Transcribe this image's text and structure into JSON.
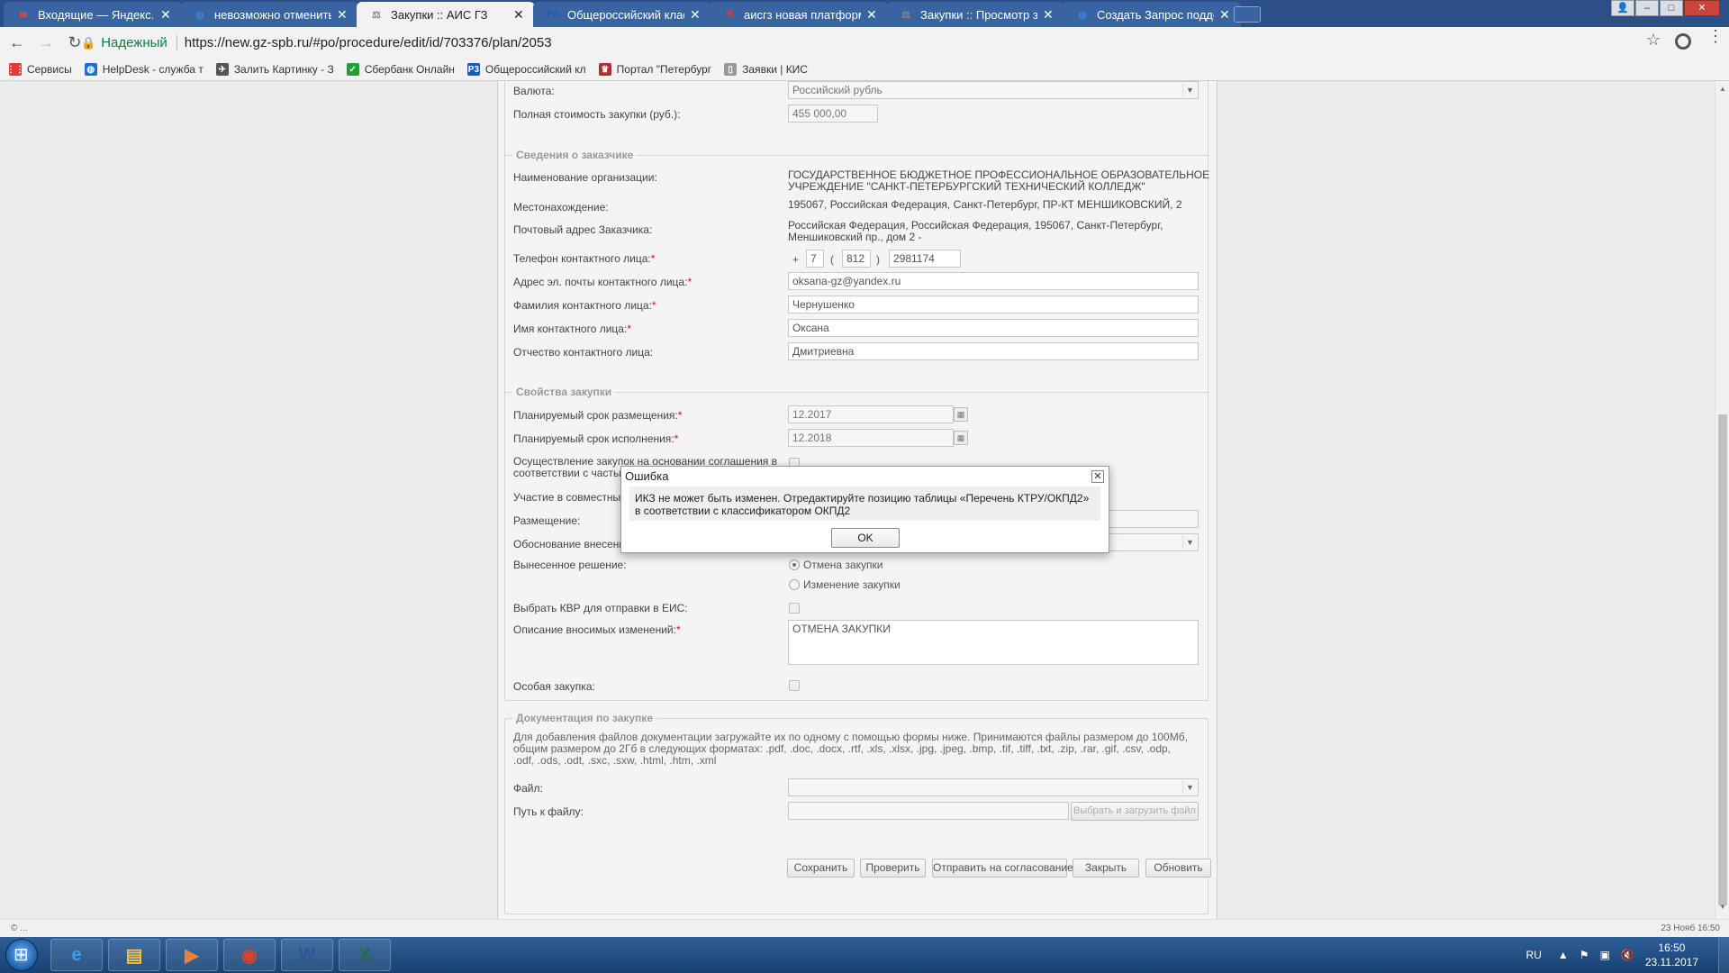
{
  "browser": {
    "tabs": [
      {
        "title": "Входящие — Яндекс.По",
        "icon": "mail-icon",
        "color": "#e04a3a",
        "active": false
      },
      {
        "title": "невозможно отменить",
        "icon": "globe-icon",
        "color": "#3a7fd5",
        "active": false
      },
      {
        "title": "Закупки :: АИС ГЗ",
        "icon": "scales-icon",
        "color": "#888888",
        "active": true
      },
      {
        "title": "Общероссийский класс",
        "icon": "p3-icon",
        "color": "#1a5bb5",
        "active": false
      },
      {
        "title": "аисгз новая платформа",
        "icon": "yandex-icon",
        "color": "#e53935",
        "active": false
      },
      {
        "title": "Закупки :: Просмотр за",
        "icon": "scales-icon",
        "color": "#888888",
        "active": false
      },
      {
        "title": "Создать Запрос подде",
        "icon": "globe-icon",
        "color": "#3a7fd5",
        "active": false
      }
    ],
    "secure_label": "Надежный",
    "url": "https://new.gz-spb.ru/#po/procedure/edit/id/703376/plan/2053",
    "bookmarks": [
      {
        "label": "Сервисы",
        "icon": "apps-icon",
        "color": "#e53935"
      },
      {
        "label": "HelpDesk - служба т",
        "icon": "helpdesk-icon",
        "color": "#1e6fd9"
      },
      {
        "label": "Залить Картинку - З",
        "icon": "image-icon",
        "color": "#555555"
      },
      {
        "label": "Сбербанк Онлайн",
        "icon": "sber-icon",
        "color": "#21a038"
      },
      {
        "label": "Общероссийский кл",
        "icon": "p3-icon",
        "color": "#1a5bb5"
      },
      {
        "label": "Портал \"Петербург",
        "icon": "emblem-icon",
        "color": "#b03030"
      },
      {
        "label": "Заявки | КИС",
        "icon": "page-icon",
        "color": "#999999"
      }
    ]
  },
  "form": {
    "currency": {
      "label": "Валюта:",
      "value": "Российский рубль"
    },
    "total_cost": {
      "label": "Полная стоимость закупки (руб.):",
      "value": "455 000,00"
    },
    "customer": {
      "legend": "Сведения о заказчике",
      "org_name_label": "Наименование организации:",
      "org_name_line1": "ГОСУДАРСТВЕННОЕ БЮДЖЕТНОЕ ПРОФЕССИОНАЛЬНОЕ ОБРАЗОВАТЕЛЬНОЕ",
      "org_name_line2": "УЧРЕЖДЕНИЕ \"САНКТ-ПЕТЕРБУРГСКИЙ ТЕХНИЧЕСКИЙ КОЛЛЕДЖ\"",
      "location_label": "Местонахождение:",
      "location_value": "195067, Российская Федерация, Санкт-Петербург, ПР-КТ МЕНШИКОВСКИЙ, 2",
      "postal_label": "Почтовый адрес Заказчика:",
      "postal_line1": "Российская Федерация, Российская Федерация, 195067, Санкт-Петербург,",
      "postal_line2": "Меншиковский пр., дом 2 -",
      "phone_label": "Телефон контактного лица:",
      "phone_plus": "+",
      "phone_country": "7",
      "phone_open": "(",
      "phone_code": "812",
      "phone_close": ")",
      "phone_number": "2981174",
      "email_label": "Адрес эл. почты контактного лица:",
      "email_value": "oksana-gz@yandex.ru",
      "lastname_label": "Фамилия контактного лица:",
      "lastname_value": "Чернушенко",
      "firstname_label": "Имя контактного лица:",
      "firstname_value": "Оксана",
      "patronymic_label": "Отчество контактного лица:",
      "patronymic_value": "Дмитриевна",
      "required_mark": "*"
    },
    "properties": {
      "legend": "Свойства закупки",
      "placement_label": "Планируемый срок размещения:",
      "placement_value": "12.2017",
      "execution_label": "Планируемый срок исполнения:",
      "execution_value": "12.2018",
      "agreement_label_line1": "Осуществление закупок на основании соглашения в",
      "agreement_label_line2": "соответствии с частью",
      "joint_label": "Участие в совместных",
      "placement2_label": "Размещение:",
      "justification_label": "Обоснование внесени",
      "decision_label": "Вынесенное решение:",
      "decision_options": [
        "Отмена закупки",
        "Изменение закупки"
      ],
      "decision_selected": 0,
      "kvr_label": "Выбрать КВР для отправки в ЕИС:",
      "changes_label": "Описание вносимых изменений:",
      "changes_value": "ОТМЕНА ЗАКУПКИ",
      "special_label": "Особая закупка:"
    },
    "documents": {
      "legend": "Документация по закупке",
      "info_line1": "Для добавления файлов документации загружайте их по одному с помощью формы ниже. Принимаются файлы размером до 100Мб,",
      "info_line2": "общим размером до 2Гб в следующих форматах: .pdf, .doc, .docx, .rtf, .xls, .xlsx, .jpg, .jpeg, .bmp, .tif, .tiff, .txt, .zip, .rar, .gif, .csv, .odp,",
      "info_line3": ".odf, .ods, .odt, .sxc, .sxw, .html, .htm, .xml",
      "file_label": "Файл:",
      "path_label": "Путь к файлу:",
      "upload_button": "Выбрать и загрузить файл"
    },
    "actions": {
      "save": "Сохранить",
      "check": "Проверить",
      "send": "Отправить на согласование",
      "close": "Закрыть",
      "refresh": "Обновить"
    }
  },
  "dialog": {
    "title": "Ошибка",
    "message_line1": "ИКЗ не может быть изменен. Отредактируйте позицию таблицы «Перечень КТРУ/ОКПД2»",
    "message_line2": "в соответствии с классификатором ОКПД2",
    "ok": "OK"
  },
  "statusbar": {
    "left": "© ...",
    "right": "23 Нояб 16:50"
  },
  "taskbar": {
    "apps": [
      {
        "name": "ie-icon",
        "glyph": "e",
        "color": "#3c9be6"
      },
      {
        "name": "explorer-icon",
        "glyph": "▤",
        "color": "#f0c24c"
      },
      {
        "name": "media-player-icon",
        "glyph": "▶",
        "color": "#e8823a"
      },
      {
        "name": "chrome-icon",
        "glyph": "◉",
        "color": "#e0402e"
      },
      {
        "name": "word-icon",
        "glyph": "W",
        "color": "#2b5797"
      },
      {
        "name": "excel-icon",
        "glyph": "X",
        "color": "#1d7044"
      }
    ],
    "lang": "RU",
    "time": "16:50",
    "date": "23.11.2017"
  }
}
